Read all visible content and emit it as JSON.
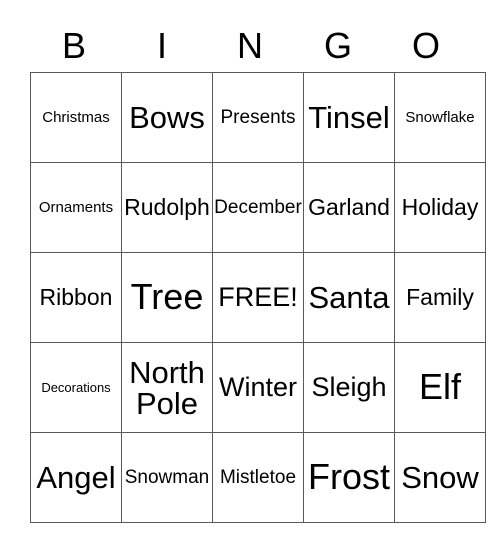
{
  "card": {
    "header_letters": [
      "B",
      "I",
      "N",
      "G",
      "O"
    ],
    "rows": [
      [
        {
          "text": "Christmas",
          "size": "s"
        },
        {
          "text": "Bows",
          "size": "xxl"
        },
        {
          "text": "Presents",
          "size": "m"
        },
        {
          "text": "Tinsel",
          "size": "xxl"
        },
        {
          "text": "Snowflake",
          "size": "s"
        }
      ],
      [
        {
          "text": "Ornaments",
          "size": "s"
        },
        {
          "text": "Rudolph",
          "size": "l"
        },
        {
          "text": "December",
          "size": "m"
        },
        {
          "text": "Garland",
          "size": "l"
        },
        {
          "text": "Holiday",
          "size": "l"
        }
      ],
      [
        {
          "text": "Ribbon",
          "size": "l"
        },
        {
          "text": "Tree",
          "size": "xxxl"
        },
        {
          "text": "FREE!",
          "size": "xl"
        },
        {
          "text": "Santa",
          "size": "xxl"
        },
        {
          "text": "Family",
          "size": "l"
        }
      ],
      [
        {
          "text": "Decorations",
          "size": "xs"
        },
        {
          "text": "North Pole",
          "size": "xxl",
          "wrap": true
        },
        {
          "text": "Winter",
          "size": "xl"
        },
        {
          "text": "Sleigh",
          "size": "xl"
        },
        {
          "text": "Elf",
          "size": "xxxl"
        }
      ],
      [
        {
          "text": "Angel",
          "size": "xxl"
        },
        {
          "text": "Snowman",
          "size": "m"
        },
        {
          "text": "Mistletoe",
          "size": "m"
        },
        {
          "text": "Frost",
          "size": "xxxl"
        },
        {
          "text": "Snow",
          "size": "xxl"
        }
      ]
    ]
  },
  "colors": {
    "background": "#ffffff",
    "text": "#000000",
    "grid_line": "#5a5a5a"
  }
}
